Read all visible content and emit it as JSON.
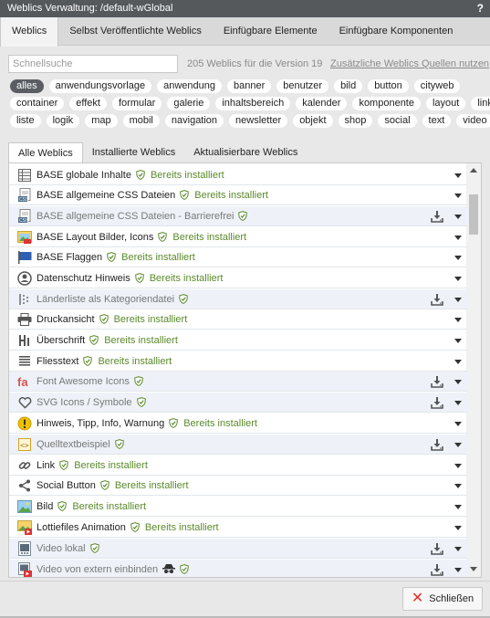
{
  "window": {
    "title": "Weblics Verwaltung: /default-wGlobal",
    "help": "?"
  },
  "main_tabs": [
    "Weblics",
    "Selbst Veröffentlichte Weblics",
    "Einfügbare Elemente",
    "Einfügbare Komponenten"
  ],
  "search": {
    "placeholder": "Schnellsuche",
    "value": ""
  },
  "count_text": "205 Weblics für die Version 19",
  "extra_sources_link": "Zusätzliche Weblics Quellen nutzen",
  "filter_rows": [
    [
      "alles",
      "anwendungsvorlage",
      "anwendung",
      "banner",
      "benutzer",
      "bild",
      "button",
      "cityweb"
    ],
    [
      "container",
      "effekt",
      "formular",
      "galerie",
      "inhaltsbereich",
      "kalender",
      "komponente",
      "layout",
      "link"
    ],
    [
      "liste",
      "logik",
      "map",
      "mobil",
      "navigation",
      "newsletter",
      "objekt",
      "shop",
      "social",
      "text",
      "video"
    ]
  ],
  "active_filter": "alles",
  "sub_tabs": [
    "Alle Weblics",
    "Installierte Weblics",
    "Aktualisierbare Weblics"
  ],
  "status_installed": "Bereits installiert",
  "colors": {
    "installed_green": "#5a8a2a",
    "titlebar": "#56595c",
    "close_red": "#dd3333"
  },
  "weblics": [
    {
      "name": "BASE globale Inhalte",
      "installed": true,
      "icon": "table-icon"
    },
    {
      "name": "BASE allgemeine CSS Dateien",
      "installed": true,
      "icon": "css-file-icon"
    },
    {
      "name": "BASE allgemeine CSS Dateien - Barrierefrei",
      "installed": false,
      "icon": "css-file-icon"
    },
    {
      "name": "BASE Layout Bilder, Icons",
      "installed": true,
      "icon": "image-folder-icon"
    },
    {
      "name": "BASE Flaggen",
      "installed": true,
      "icon": "flag-icon"
    },
    {
      "name": "Datenschutz Hinweis",
      "installed": true,
      "icon": "privacy-icon"
    },
    {
      "name": "Länderliste als Kategoriendatei",
      "installed": false,
      "icon": "list-icon"
    },
    {
      "name": "Druckansicht",
      "installed": true,
      "icon": "printer-icon"
    },
    {
      "name": "Überschrift",
      "installed": true,
      "icon": "heading-icon"
    },
    {
      "name": "Fliesstext",
      "installed": true,
      "icon": "text-lines-icon"
    },
    {
      "name": "Font Awesome Icons",
      "installed": false,
      "icon": "font-awesome-icon"
    },
    {
      "name": "SVG Icons / Symbole",
      "installed": false,
      "icon": "heart-icon"
    },
    {
      "name": "Hinweis, Tipp, Info, Warnung",
      "installed": true,
      "icon": "warning-icon"
    },
    {
      "name": "Quelltextbeispiel",
      "installed": false,
      "icon": "code-icon"
    },
    {
      "name": "Link",
      "installed": true,
      "icon": "link-icon"
    },
    {
      "name": "Social Button",
      "installed": true,
      "icon": "share-icon"
    },
    {
      "name": "Bild",
      "installed": true,
      "icon": "picture-icon"
    },
    {
      "name": "Lottiefiles Animation",
      "installed": true,
      "icon": "animation-icon"
    },
    {
      "name": "Video lokal",
      "installed": false,
      "icon": "video-file-icon"
    },
    {
      "name": "Video von extern einbinden",
      "installed": false,
      "icon": "video-external-icon",
      "spy": true
    }
  ],
  "close_button": "Schließen"
}
